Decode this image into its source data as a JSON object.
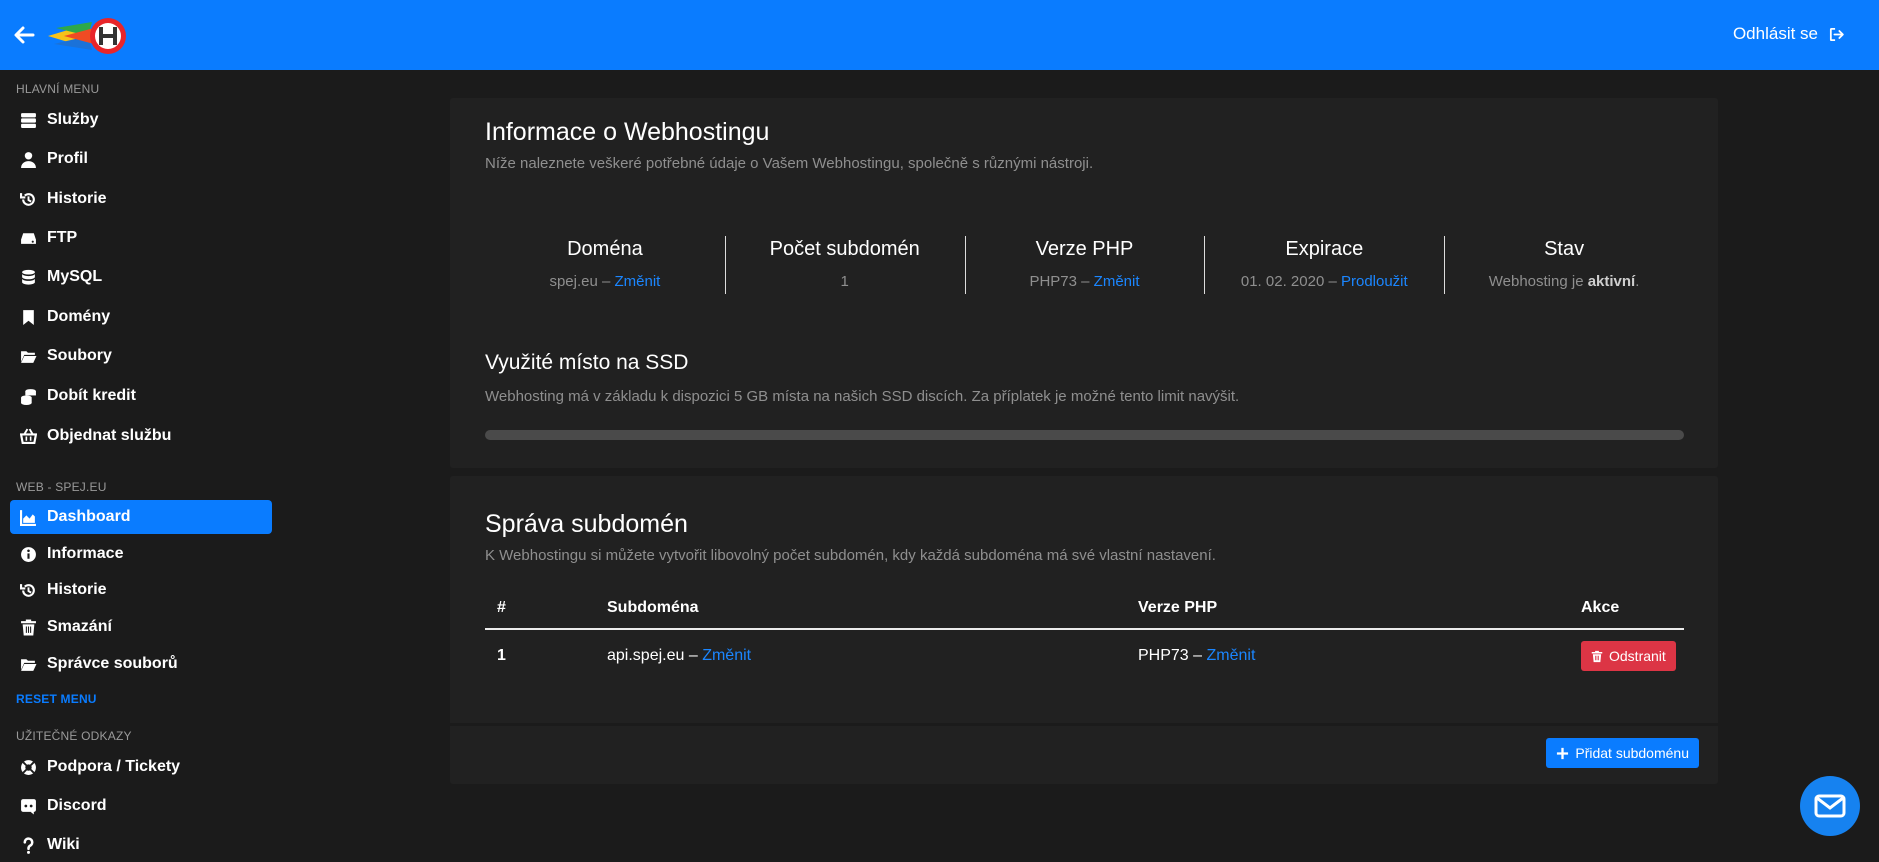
{
  "header": {
    "logout_label": "Odhlásit se"
  },
  "sidebar": {
    "main_section": "HLAVNÍ MENU",
    "main_items": [
      {
        "label": "Služby",
        "icon": "server-icon"
      },
      {
        "label": "Profil",
        "icon": "user-icon"
      },
      {
        "label": "Historie",
        "icon": "history-icon"
      },
      {
        "label": "FTP",
        "icon": "hdd-icon"
      },
      {
        "label": "MySQL",
        "icon": "database-icon"
      },
      {
        "label": "Domény",
        "icon": "bookmark-icon"
      },
      {
        "label": "Soubory",
        "icon": "folder-open-icon"
      },
      {
        "label": "Dobít kredit",
        "icon": "coins-icon"
      },
      {
        "label": "Objednat službu",
        "icon": "basket-icon"
      }
    ],
    "web_section": "WEB - SPEJ.EU",
    "web_items": [
      {
        "label": "Dashboard",
        "icon": "chart-area-icon",
        "active": true
      },
      {
        "label": "Informace",
        "icon": "info-circle-icon"
      },
      {
        "label": "Historie",
        "icon": "history-icon"
      },
      {
        "label": "Smazání",
        "icon": "trash-icon"
      },
      {
        "label": "Správce souborů",
        "icon": "folder-open-icon"
      }
    ],
    "reset_menu": "RESET MENU",
    "links_section": "UŽITEČNÉ ODKAZY",
    "link_items": [
      {
        "label": "Podpora / Tickety",
        "icon": "lifebuoy-icon"
      },
      {
        "label": "Discord",
        "icon": "discord-icon"
      },
      {
        "label": "Wiki",
        "icon": "question-icon"
      }
    ]
  },
  "info": {
    "title": "Informace o Webhostingu",
    "subtitle": "Níže naleznete veškeré potřebné údaje o Vašem Webhostingu, společně s různými nástroji.",
    "stats": [
      {
        "head": "Doména",
        "value": "spej.eu",
        "sep": " – ",
        "link": "Změnit"
      },
      {
        "head": "Počet subdomén",
        "value": "1"
      },
      {
        "head": "Verze PHP",
        "value": "PHP73",
        "sep": " – ",
        "link": "Změnit"
      },
      {
        "head": "Expirace",
        "value": "01. 02. 2020",
        "sep": " – ",
        "link": "Prodloužit"
      },
      {
        "head": "Stav",
        "value_prefix": "Webhosting je ",
        "value_bold": "aktivní",
        "value_suffix": "."
      }
    ]
  },
  "ssd": {
    "title": "Využité místo na SSD",
    "subtitle": "Webhosting má v základu k dispozici 5 GB místa na našich SSD discích. Za příplatek je možné tento limit navýšit.",
    "usage_fraction": 0
  },
  "subdomains": {
    "title": "Správa subdomén",
    "subtitle": "K Webhostingu si můžete vytvořit libovolný počet subdomén, kdy každá subdoména má své vlastní nastavení.",
    "columns": [
      "#",
      "Subdoména",
      "Verze PHP",
      "Akce"
    ],
    "rows": [
      {
        "num": "1",
        "subdomain": "api.spej.eu",
        "sub_link": "Změnit",
        "php": "PHP73",
        "php_link": "Změnit",
        "action": "Odstranit"
      }
    ],
    "sep": " – ",
    "add_button": "Přidat subdoménu"
  },
  "colors": {
    "accent": "#0a7cff",
    "danger": "#dc3545",
    "background": "#1b1b1b",
    "card": "#212121"
  }
}
